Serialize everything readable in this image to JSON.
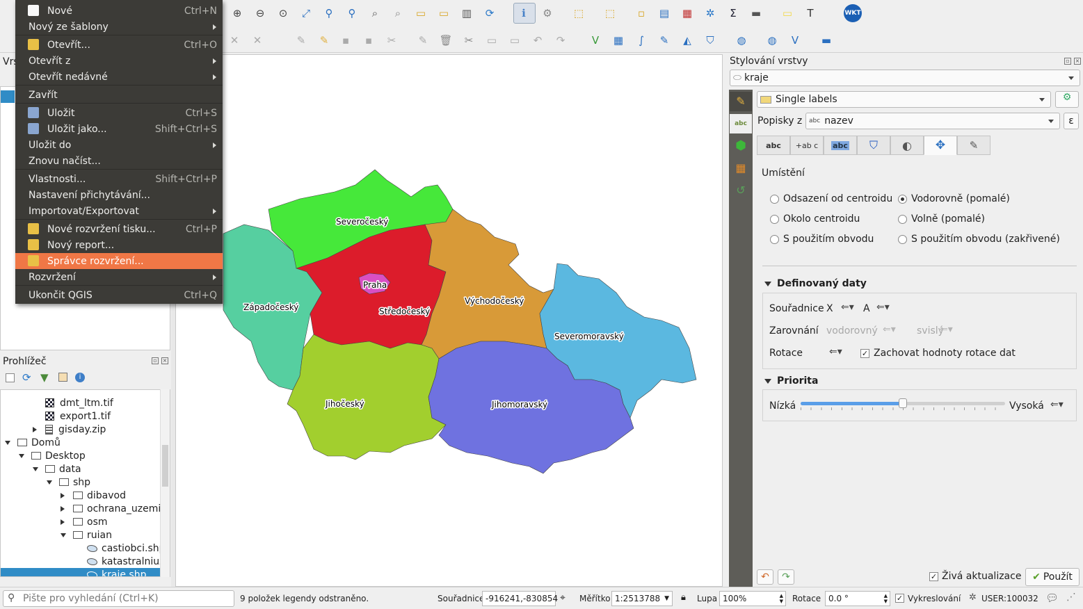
{
  "menu": {
    "items": [
      {
        "label": "Nové",
        "shortcut": "Ctrl+N"
      },
      {
        "label": "Nový ze šablony"
      },
      {
        "label": "Otevřít...",
        "shortcut": "Ctrl+O"
      },
      {
        "label": "Otevřít z"
      },
      {
        "label": "Otevřít nedávné"
      },
      {
        "label": "Zavřít"
      },
      {
        "label": "Uložit",
        "shortcut": "Ctrl+S"
      },
      {
        "label": "Uložit jako...",
        "shortcut": "Shift+Ctrl+S"
      },
      {
        "label": "Uložit do"
      },
      {
        "label": "Znovu načíst..."
      },
      {
        "label": "Vlastnosti...",
        "shortcut": "Shift+Ctrl+P"
      },
      {
        "label": "Nastavení přichytávání..."
      },
      {
        "label": "Importovat/Exportovat"
      },
      {
        "label": "Nové rozvržení tisku...",
        "shortcut": "Ctrl+P"
      },
      {
        "label": "Nový report..."
      },
      {
        "label": "Správce rozvržení..."
      },
      {
        "label": "Rozvržení"
      },
      {
        "label": "Ukončit QGIS",
        "shortcut": "Ctrl+Q"
      }
    ]
  },
  "toolbar": {
    "wkt": "WKT"
  },
  "layers_panel": {
    "title": "Vrs"
  },
  "browser": {
    "title": "Prohlížeč",
    "items": [
      "dmt_ltm.tif",
      "export1.tif",
      "gisday.zip",
      "Domů",
      "Desktop",
      "data",
      "shp",
      "dibavod",
      "ochrana_uzemi",
      "osm",
      "ruian",
      "castiobci.shp",
      "katastralniuz",
      "kraje.shp"
    ]
  },
  "map": {
    "regions": [
      "Severočeský",
      "Západočeský",
      "Praha",
      "Středočeský",
      "Východočeský",
      "Severomoravský",
      "Jihočeský",
      "Jihomoravský"
    ]
  },
  "styling": {
    "title": "Stylování vrstvy",
    "layer": "kraje",
    "mode": "Single labels",
    "labels_from_prefix": "Popisky z",
    "field_tag": "abc",
    "field": "nazev",
    "tab_labels": [
      "abc",
      "+ab c",
      "abc"
    ],
    "placement_heading": "Umístění",
    "placement_options": [
      "Odsazení od centroidu",
      "Vodorovně (pomalé)",
      "Okolo centroidu",
      "Volně (pomalé)",
      "S použitím obvodu",
      "S použitím obvodu (zakřivené)"
    ],
    "defined_heading": "Definovaný daty",
    "coords_label": "Souřadnice",
    "x_label": "X",
    "a_label": "A",
    "align_label": "Zarovnání",
    "align_h": "vodorovný",
    "align_v": "svislý",
    "rotation_label": "Rotace",
    "keep_rotation": "Zachovat hodnoty rotace dat",
    "priority_heading": "Priorita",
    "low": "Nízká",
    "high": "Vysoká",
    "priority_value": 0.5,
    "live_update": "Živá aktualizace",
    "apply": "Použít"
  },
  "status": {
    "search_placeholder": "Pište pro vyhledání (Ctrl+K)",
    "message": "9 položek legendy odstraněno.",
    "coords_label": "Souřadnice",
    "coords": "-916241,-830854",
    "scale_label": "Měřítko",
    "scale": "1:2513788",
    "zoom_label": "Lupa",
    "zoom": "100%",
    "rotation_label": "Rotace",
    "rotation": "0.0 °",
    "render_label": "Vykreslování",
    "crs": "USER:100032"
  }
}
